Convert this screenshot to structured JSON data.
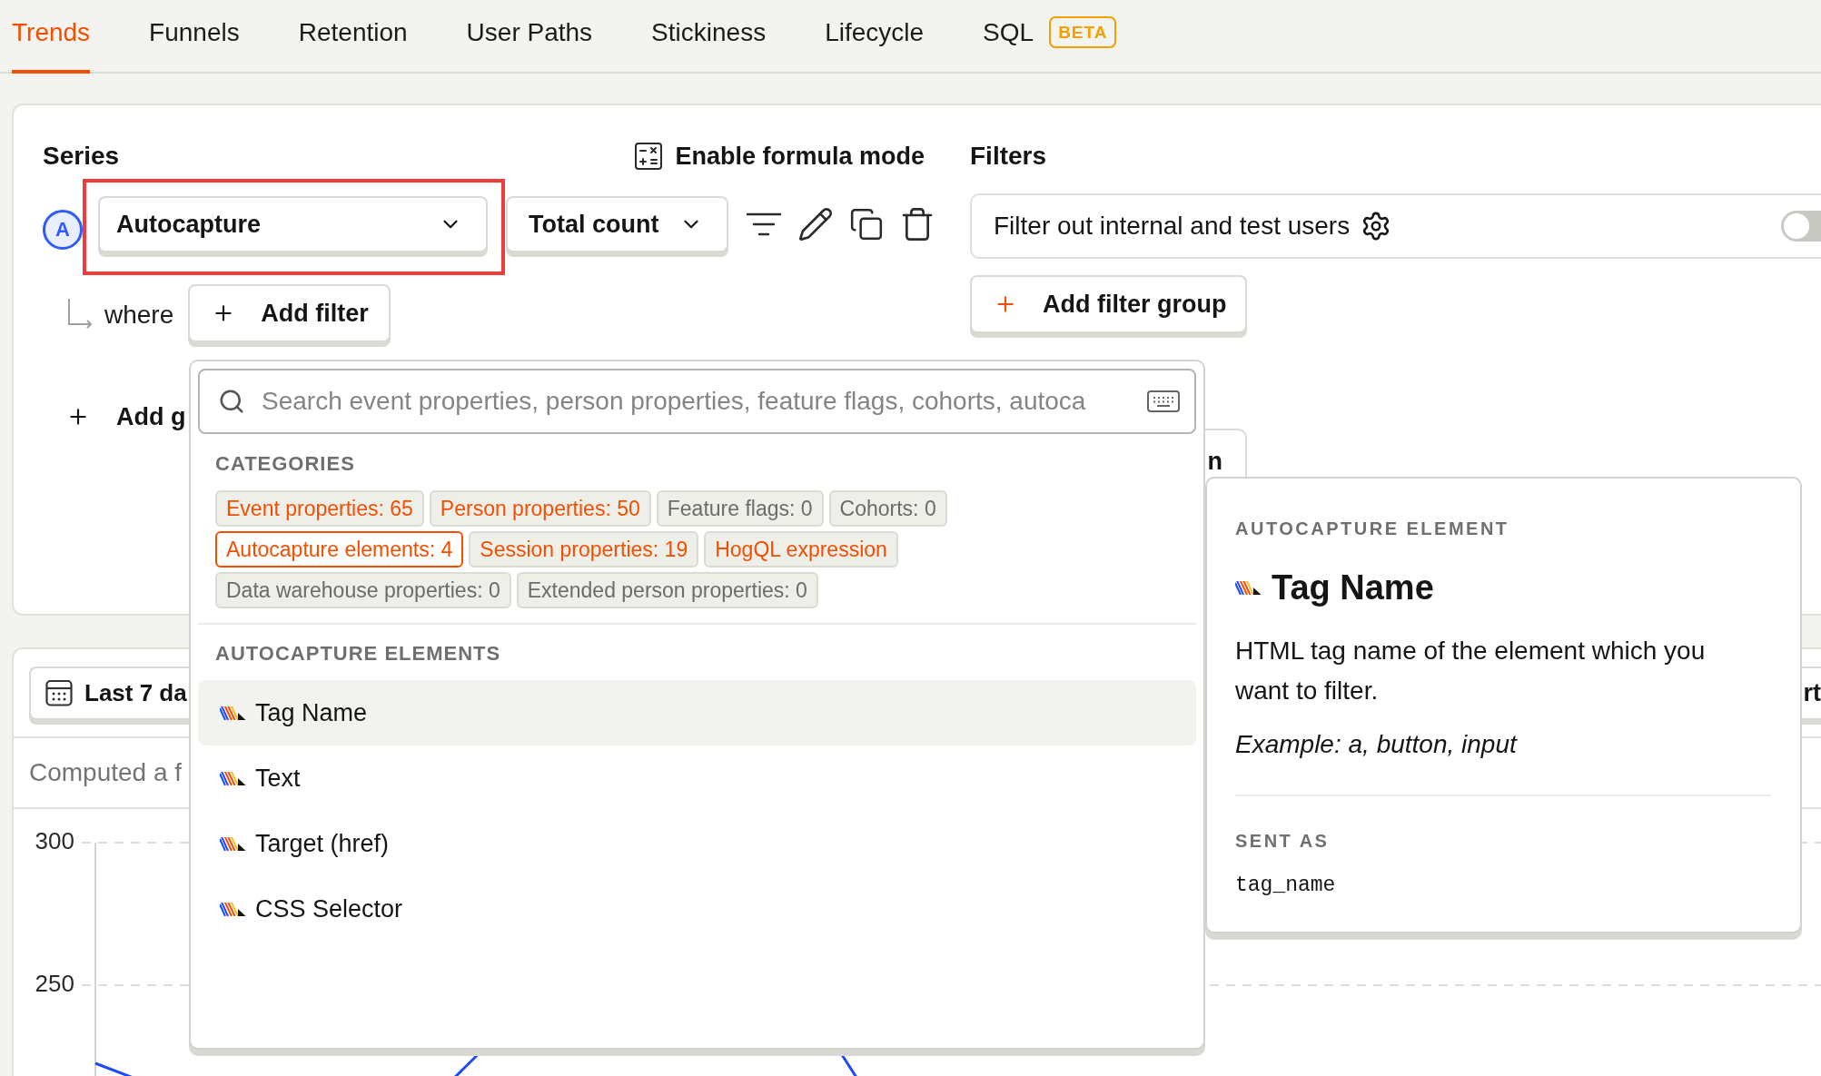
{
  "tabs": [
    {
      "label": "Trends",
      "selected": true
    },
    {
      "label": "Funnels",
      "selected": false
    },
    {
      "label": "Retention",
      "selected": false
    },
    {
      "label": "User Paths",
      "selected": false
    },
    {
      "label": "Stickiness",
      "selected": false
    },
    {
      "label": "Lifecycle",
      "selected": false
    },
    {
      "label": "SQL",
      "selected": false,
      "badge": "BETA"
    }
  ],
  "series_panel": {
    "heading": "Series",
    "formula_button": "Enable formula mode",
    "series": [
      {
        "letter": "A",
        "event": "Autocapture",
        "highlighted": true,
        "aggregation": "Total count",
        "connector": "where",
        "add_filter_button": "Add filter"
      }
    ],
    "add_series_button": "Add g"
  },
  "filters_panel": {
    "heading": "Filters",
    "internal_filter": {
      "label": "Filter out internal and test users",
      "on": false
    },
    "add_filter_group_button": "Add filter group",
    "partial_button": "n"
  },
  "insight_panel": {
    "date_range_button": "Last 7 da",
    "partial_button": "rt",
    "computed_note": "Computed a f",
    "y_axis_labels": [
      "300",
      "250"
    ]
  },
  "property_popover": {
    "search": {
      "placeholder": "Search event properties, person properties, feature flags, cohorts, autoca"
    },
    "categories_heading": "CATEGORIES",
    "categories": [
      {
        "label": "Event properties: 65",
        "disabled": false,
        "selected": false
      },
      {
        "label": "Person properties: 50",
        "disabled": false,
        "selected": false
      },
      {
        "label": "Feature flags: 0",
        "disabled": true,
        "selected": false
      },
      {
        "label": "Cohorts: 0",
        "disabled": true,
        "selected": false
      },
      {
        "label": "Autocapture elements: 4",
        "disabled": false,
        "selected": true
      },
      {
        "label": "Session properties: 19",
        "disabled": false,
        "selected": false
      },
      {
        "label": "HogQL expression",
        "disabled": false,
        "selected": false
      },
      {
        "label": "Data warehouse properties: 0",
        "disabled": true,
        "selected": false
      },
      {
        "label": "Extended person properties: 0",
        "disabled": true,
        "selected": false
      }
    ],
    "section_heading": "AUTOCAPTURE ELEMENTS",
    "items": [
      {
        "label": "Tag Name",
        "selected": true
      },
      {
        "label": "Text",
        "selected": false
      },
      {
        "label": "Target (href)",
        "selected": false
      },
      {
        "label": "CSS Selector",
        "selected": false
      }
    ]
  },
  "detail_panel": {
    "kind_label": "AUTOCAPTURE ELEMENT",
    "title": "Tag Name",
    "description": "HTML tag name of the element which you want to filter.",
    "example": "Example: a, button, input",
    "sent_as_label": "SENT AS",
    "sent_as": "tag_name"
  }
}
